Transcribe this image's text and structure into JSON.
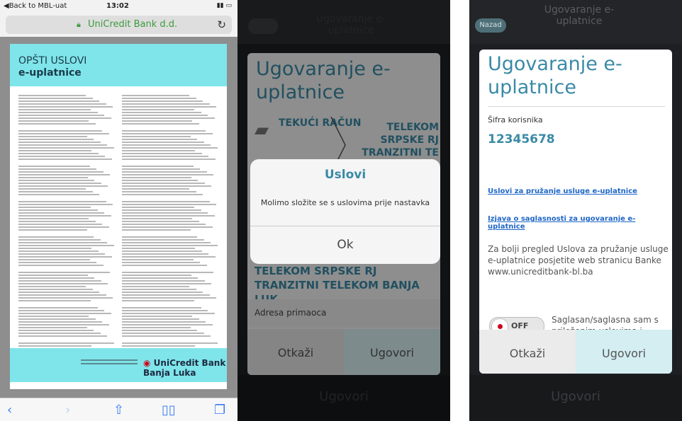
{
  "safari": {
    "status_back": "◀Back to MBL-uat",
    "time": "13:02",
    "url": "UniCredit Bank d.d.",
    "doc_title_line1": "OPŠTI USLOVI",
    "doc_title_line2": "e-uplatnice",
    "footer_logo": "UniCredit Bank Banja Luka"
  },
  "terms_screen": {
    "title": "Ugovaranje e-uplatnice",
    "from_account": "TEKUĆI RAČUN",
    "to_account": "TELEKOM SRPSKE RJ TRANZITNI TE",
    "recipient": "TELEKOM SRPSKE RJ TRANZITNI TELEKOM BANJA LUK",
    "address_label": "Adresa primaoca",
    "cancel_label": "Otkaži",
    "confirm_label": "Ugovori",
    "bottom_label": "Ugovori",
    "dialog": {
      "title": "Uslovi",
      "message": "Molimo složite se s uslovima prije nastavka",
      "ok": "Ok"
    }
  },
  "contract_screen": {
    "back_label": "Nazad",
    "header_title": "Ugovaranje e-uplatnice",
    "title": "Ugovaranje e-uplatnice",
    "user_code_label": "Šifra korisnika",
    "user_code": "12345678",
    "link_terms": "Uslovi za pružanje usluge e-uplatnice",
    "link_consent": "Izjava o saglasnosti za ugovaranje e-uplatnice",
    "info_text": "Za bolji pregled Uslova za pružanje usluge e-uplatnice posjetite web stranicu Banke www.unicreditbank-bl.ba",
    "toggle_state": "OFF",
    "agree_text": "Saglasan/saglasna sam s priloženim uslovima i izjavom",
    "cancel_label": "Otkaži",
    "confirm_label": "Ugovori",
    "bottom_label": "Ugovori"
  },
  "colors": {
    "accent": "#3a8aa6",
    "doc_header": "#7fe5ea",
    "link": "#1f66c7",
    "toggle_dot": "#d0021b"
  }
}
